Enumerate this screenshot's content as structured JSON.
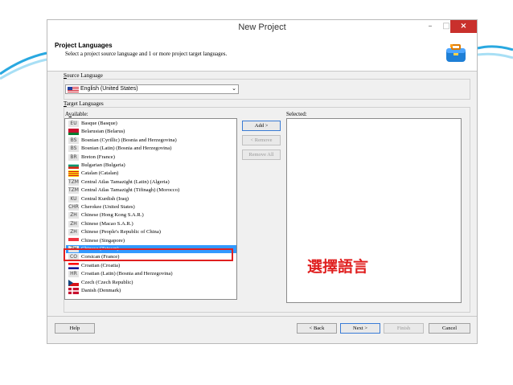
{
  "window": {
    "title": "New Project",
    "min": "–",
    "max": "□",
    "close": "×"
  },
  "header": {
    "title": "Project Languages",
    "subtitle": "Select a project source language and 1 or more project target languages.",
    "icon": "suitcase-icon"
  },
  "source": {
    "label_u": "S",
    "label_rest": "ource Language",
    "value": "English (United States)",
    "arrow": "⌄"
  },
  "target": {
    "label_u": "T",
    "label_rest": "arget Languages",
    "available_u": "v",
    "available_pre": "A",
    "available_post": "ailable:",
    "selected_label": "Selected:"
  },
  "languages": [
    {
      "code": "EU",
      "name": "Basque (Basque)"
    },
    {
      "code": "",
      "name": "Belarusian (Belarus)",
      "flag": "belarus"
    },
    {
      "code": "BS",
      "name": "Bosnian (Cyrillic) (Bosnia and Herzegovina)"
    },
    {
      "code": "BS",
      "name": "Bosnian (Latin) (Bosnia and Herzegovina)"
    },
    {
      "code": "BR",
      "name": "Breton (France)"
    },
    {
      "code": "",
      "name": "Bulgarian (Bulgaria)",
      "flag": "bulgaria"
    },
    {
      "code": "",
      "name": "Catalan (Catalan)",
      "flag": "catalan"
    },
    {
      "code": "TZM",
      "name": "Central Atlas Tamazight (Latin) (Algeria)"
    },
    {
      "code": "TZM",
      "name": "Central Atlas Tamazight (Tifinagh) (Morocco)"
    },
    {
      "code": "KU",
      "name": "Central Kurdish (Iraq)"
    },
    {
      "code": "CHR",
      "name": "Cherokee (United States)"
    },
    {
      "code": "ZH",
      "name": "Chinese (Hong Kong S.A.R.)"
    },
    {
      "code": "ZH",
      "name": "Chinese (Macao S.A.R.)"
    },
    {
      "code": "ZH",
      "name": "Chinese (People's Republic of China)"
    },
    {
      "code": "",
      "name": "Chinese (Singapore)",
      "flag": "singapore"
    },
    {
      "code": "ZH",
      "name": "Chinese (Taiwan)",
      "selected": true
    },
    {
      "code": "CO",
      "name": "Corsican (France)"
    },
    {
      "code": "",
      "name": "Croatian (Croatia)",
      "flag": "croatia"
    },
    {
      "code": "HR",
      "name": "Croatian (Latin) (Bosnia and Herzegovina)"
    },
    {
      "code": "",
      "name": "Czech (Czech Republic)",
      "flag": "czech"
    },
    {
      "code": "",
      "name": "Danish (Denmark)",
      "flag": "denmark"
    }
  ],
  "buttons": {
    "add": "Add >",
    "remove": "< Remove",
    "remove_all": "Remove All",
    "help": "Help",
    "back": "< Back",
    "next": "Next >",
    "finish": "Finish",
    "cancel": "Cancel"
  },
  "annotation": "選擇語言",
  "colors": {
    "highlight": "#3399ff",
    "annotation": "#e02020",
    "close": "#c9302c"
  }
}
